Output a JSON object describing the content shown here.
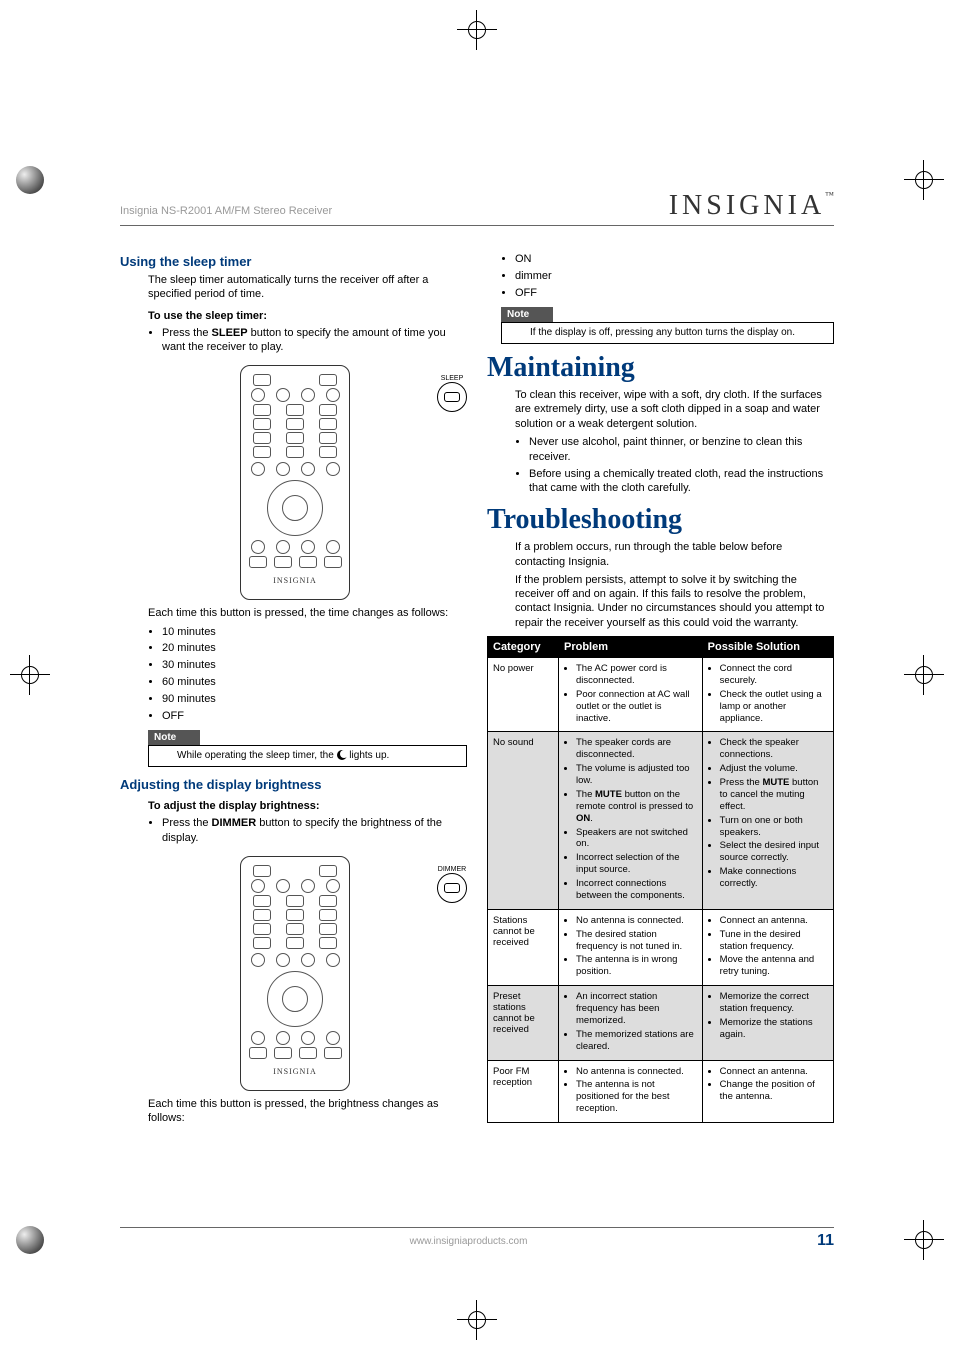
{
  "doc_title": "Insignia NS-R2001 AM/FM Stereo Receiver",
  "brand": "INSIGNIA",
  "brand_tm": "™",
  "footer": {
    "url": "www.insigniaproducts.com",
    "page_number": "11"
  },
  "left": {
    "sleep_heading": "Using the sleep timer",
    "sleep_intro": "The sleep timer automatically turns the receiver off after a specified period of time.",
    "sleep_sub": "To use the sleep timer:",
    "sleep_step_pre": "Press the ",
    "sleep_step_btn": "SLEEP",
    "sleep_step_post": " button to specify the amount of time you want the receiver to play.",
    "sleep_callout_label": "SLEEP",
    "sleep_list_intro": "Each time this button is pressed, the time changes as follows:",
    "sleep_list": [
      "10 minutes",
      "20 minutes",
      "30 minutes",
      "60 minutes",
      "90 minutes",
      "OFF"
    ],
    "note_label": "Note",
    "sleep_note_pre": "While operating the sleep timer, the ",
    "sleep_note_post": " lights up.",
    "dim_heading": "Adjusting the display brightness",
    "dim_sub": "To adjust the display brightness:",
    "dim_step_pre": "Press the ",
    "dim_step_btn": "DIMMER",
    "dim_step_post": " button to specify the brightness of the display.",
    "dim_callout_label": "DIMMER",
    "dim_list_intro": "Each time this button is pressed, the brightness changes as follows:"
  },
  "right": {
    "dim_list": [
      "ON",
      "dimmer",
      "OFF"
    ],
    "note_label": "Note",
    "dim_note": "If the display is off, pressing any button turns the display on.",
    "maint_heading": "Maintaining",
    "maint_intro": "To clean this receiver, wipe with a soft, dry cloth. If the surfaces are extremely dirty, use a soft cloth dipped in a soap and water solution or a weak detergent solution.",
    "maint_list": [
      "Never use alcohol, paint thinner, or benzine to clean this receiver.",
      "Before using a chemically treated cloth, read the instructions that came with the cloth carefully."
    ],
    "ts_heading": "Troubleshooting",
    "ts_intro1": "If a problem occurs, run through the table below before contacting Insignia.",
    "ts_intro2": "If the problem persists, attempt to solve it by switching the receiver off and on again. If this fails to resolve the problem, contact Insignia. Under no circumstances should you attempt to repair the receiver yourself as this could void the warranty.",
    "ts_headers": {
      "c1": "Category",
      "c2": "Problem",
      "c3": "Possible Solution"
    },
    "ts_rows": [
      {
        "cat": "No power",
        "problem": [
          "The AC power cord is disconnected.",
          "Poor connection at AC wall outlet or the outlet is inactive."
        ],
        "solution": [
          "Connect the cord securely.",
          "Check the outlet using a lamp or another appliance."
        ]
      },
      {
        "cat": "No sound",
        "problem": [
          "The speaker cords are disconnected.",
          "The volume is adjusted too low.",
          "The MUTE button on the remote control is pressed to ON.",
          "Speakers are not switched on.",
          "Incorrect selection of the input source.",
          "Incorrect connections between the components."
        ],
        "solution": [
          "Check the speaker connections.",
          "Adjust the volume.",
          "Press the MUTE button to cancel the muting effect.",
          "Turn on one or both speakers.",
          "Select the desired input source correctly.",
          "Make connections correctly."
        ]
      },
      {
        "cat": "Stations cannot be received",
        "problem": [
          "No antenna is connected.",
          "The desired station frequency is not tuned in.",
          "The antenna is in wrong position."
        ],
        "solution": [
          "Connect an antenna.",
          "Tune in the desired station frequency.",
          "Move the antenna and retry tuning."
        ]
      },
      {
        "cat": "Preset stations cannot be received",
        "problem": [
          "An incorrect station frequency has been memorized.",
          "The memorized stations are cleared."
        ],
        "solution": [
          "Memorize the correct station frequency.",
          "Memorize the stations again."
        ]
      },
      {
        "cat": "Poor FM reception",
        "problem": [
          "No antenna is connected.",
          "The antenna is not positioned for the best reception."
        ],
        "solution": [
          "Connect an antenna.",
          "Change the position of the antenna."
        ]
      }
    ]
  }
}
